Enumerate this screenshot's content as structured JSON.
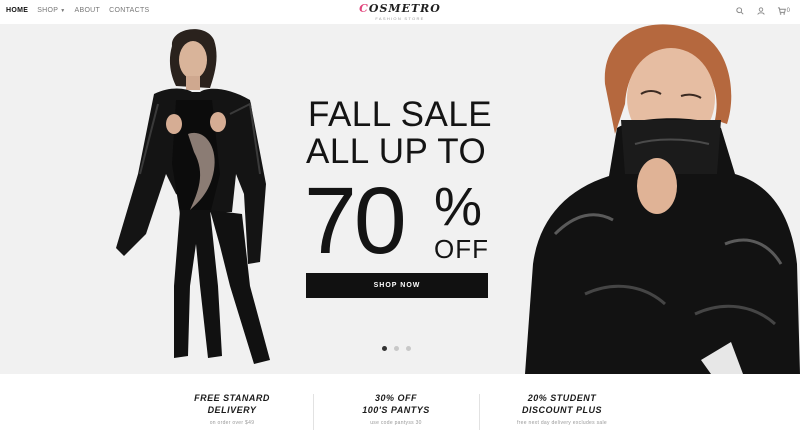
{
  "nav": {
    "home": "HOME",
    "shop": "SHOP",
    "about": "ABOUT",
    "contacts": "CONTACTS"
  },
  "brand": {
    "name_accent": "C",
    "name_rest": "OSMETRO",
    "tagline": "FASHION STORE"
  },
  "header": {
    "icons": [
      "search-icon",
      "user-icon",
      "cart-icon"
    ],
    "cart_count": "0"
  },
  "hero": {
    "line1": "FALL SALE",
    "line2": "ALL UP TO",
    "discount": "70",
    "percent": "%",
    "off": "OFF",
    "cta": "SHOP NOW",
    "slides": 3,
    "active_slide": 1
  },
  "features": [
    {
      "title_line1": "FREE STANARD",
      "title_line2": "DELIVERY",
      "subtitle": "on order over $49"
    },
    {
      "title_line1": "30% OFF",
      "title_line2": "100'S PANTYS",
      "subtitle": "use code pantyss 30"
    },
    {
      "title_line1": "20% STUDENT",
      "title_line2": "DISCOUNT PLUS",
      "subtitle": "free next day delivery excludes sale"
    }
  ],
  "colors": {
    "accent": "#e2457c",
    "dark": "#111111",
    "hero_bg": "#f1f1f1"
  }
}
